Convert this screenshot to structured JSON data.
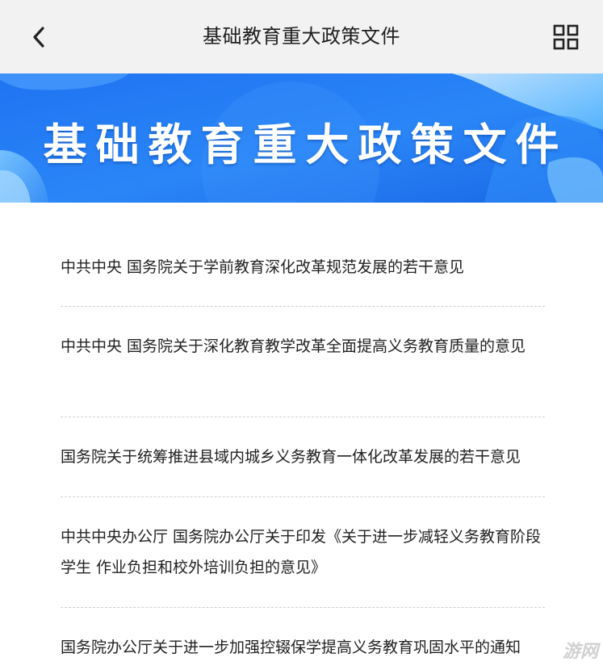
{
  "header": {
    "title": "基础教育重大政策文件",
    "back_icon": "chevron-left-icon",
    "menu_icon": "grid-icon"
  },
  "banner": {
    "title": "基础教育重大政策文件",
    "colors": {
      "primary": "#1a6ff0",
      "light": "#4fb4ff"
    }
  },
  "policies": [
    {
      "title": "中共中央 国务院关于学前教育深化改革规范发展的若干意见"
    },
    {
      "title": "中共中央 国务院关于深化教育教学改革全面提高义务教育质量的意见"
    },
    {
      "title": "国务院关于统筹推进县域内城乡义务教育一体化改革发展的若干意见"
    },
    {
      "title": "中共中央办公厅 国务院办公厅关于印发《关于进一步减轻义务教育阶段学生 作业负担和校外培训负担的意见》"
    },
    {
      "title": "国务院办公厅关于进一步加强控辍保学提高义务教育巩固水平的通知"
    }
  ],
  "watermark": "游网"
}
